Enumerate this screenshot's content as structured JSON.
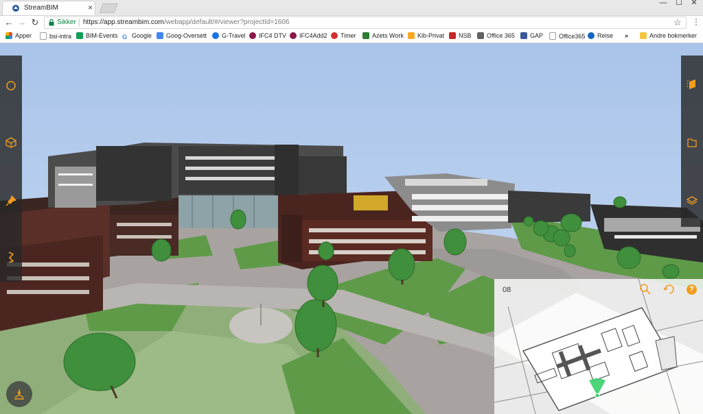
{
  "browser": {
    "tab_title": "StreamBIM",
    "tab_close": "×",
    "nav_back": "←",
    "nav_forward": "→",
    "nav_reload": "↻",
    "secure_label": "Sikker",
    "url_host": "https://app.streambim.com",
    "url_path": "/webapp/default/#/viewer?projectId=1606",
    "star": "☆",
    "menu": "⋮",
    "window_minimize": "—",
    "window_maximize": "☐",
    "window_close": "✕"
  },
  "bookmarks": {
    "items": [
      {
        "label": "Apper",
        "icon": "apps-grid-icon",
        "color": "#e44d26"
      },
      {
        "label": "bsi-intra",
        "icon": "page-icon",
        "color": "#9e9e9e"
      },
      {
        "label": "BIM-Events",
        "icon": "sheet-icon",
        "color": "#0f9d58"
      },
      {
        "label": "Google",
        "icon": "google-icon",
        "color": "#4285f4"
      },
      {
        "label": "Goog-Oversett",
        "icon": "translate-icon",
        "color": "#4285f4"
      },
      {
        "label": "G-Travel",
        "icon": "travel-icon",
        "color": "#1a73e8"
      },
      {
        "label": "IFC4 DTV",
        "icon": "ifc-icon",
        "color": "#8b1a4a"
      },
      {
        "label": "IFC4Add2",
        "icon": "ifc-icon",
        "color": "#8b1a4a"
      },
      {
        "label": "Timer",
        "icon": "timer-icon",
        "color": "#d32f2f"
      },
      {
        "label": "Azets Work",
        "icon": "azets-icon",
        "color": "#2e7d32"
      },
      {
        "label": "Kib-Privat",
        "icon": "kib-icon",
        "color": "#f9a825"
      },
      {
        "label": "NSB",
        "icon": "nsb-icon",
        "color": "#c62828"
      },
      {
        "label": "Office 365",
        "icon": "office-icon",
        "color": "#616161"
      },
      {
        "label": "GAP",
        "icon": "facebook-icon",
        "color": "#3b5998"
      },
      {
        "label": "Office365",
        "icon": "page-icon",
        "color": "#9e9e9e"
      },
      {
        "label": "Reise",
        "icon": "globe-icon",
        "color": "#1565c0"
      }
    ],
    "overflow": "»",
    "other_label": "Andre bokmerker",
    "other_icon": "folder-icon"
  },
  "viewer": {
    "accent_color": "#f29d1f",
    "panel_color": "#2a2a2a",
    "left_tools": [
      "circle-icon",
      "box-icon",
      "pin-icon",
      "measure-icon"
    ],
    "right_tools": [
      "section-box-icon",
      "document-icon",
      "layers-icon"
    ],
    "bottom_tool": "viewpoint-icon"
  },
  "minimap": {
    "floor_label": "08",
    "tools": [
      "search-icon",
      "rotate-icon"
    ],
    "help_label": "?"
  }
}
